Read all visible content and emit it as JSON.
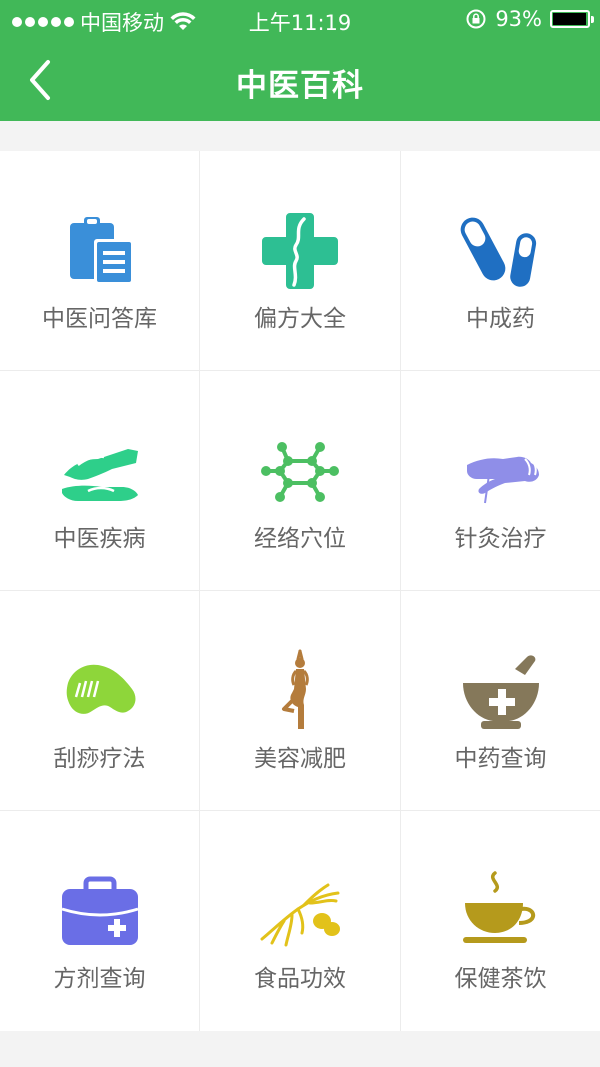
{
  "status_bar": {
    "carrier": "中国移动",
    "time": "上午11:19",
    "battery": "93%"
  },
  "header": {
    "title": "中医百科"
  },
  "grid": {
    "items": [
      {
        "label": "中医问答库",
        "icon": "clipboard-icon",
        "color": "#3a8fd9"
      },
      {
        "label": "偏方大全",
        "icon": "medical-cross-face-icon",
        "color": "#2dbf93"
      },
      {
        "label": "中成药",
        "icon": "pills-icon",
        "color": "#1f6fc2"
      },
      {
        "label": "中医疾病",
        "icon": "massage-hands-icon",
        "color": "#2ecf8a"
      },
      {
        "label": "经络穴位",
        "icon": "meridian-points-icon",
        "color": "#4cbf62"
      },
      {
        "label": "针灸治疗",
        "icon": "acupuncture-hand-icon",
        "color": "#8f8ee8"
      },
      {
        "label": "刮痧疗法",
        "icon": "gua-sha-scraper-icon",
        "color": "#8ed63a"
      },
      {
        "label": "美容减肥",
        "icon": "yoga-figure-icon",
        "color": "#b47c3c"
      },
      {
        "label": "中药查询",
        "icon": "mortar-pestle-icon",
        "color": "#85785a"
      },
      {
        "label": "方剂查询",
        "icon": "medical-kit-icon",
        "color": "#6a6ee6"
      },
      {
        "label": "食品功效",
        "icon": "ginseng-icon",
        "color": "#e2c21a"
      },
      {
        "label": "保健茶饮",
        "icon": "tea-cup-icon",
        "color": "#b59a1c"
      }
    ]
  }
}
